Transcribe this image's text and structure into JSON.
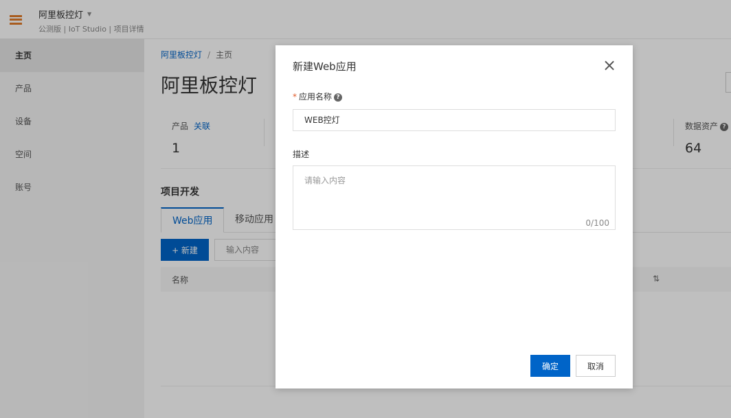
{
  "header": {
    "project_title": "阿里板控灯",
    "caret_icon": "caret-down-icon",
    "subtitle": "公测版 | IoT Studio | 项目详情",
    "accent_color": "#e07b2a"
  },
  "sidebar": {
    "items": [
      {
        "label": "主页"
      },
      {
        "label": "产品"
      },
      {
        "label": "设备"
      },
      {
        "label": "空间"
      },
      {
        "label": "账号"
      }
    ]
  },
  "main": {
    "breadcrumb": {
      "project": "阿里板控灯",
      "sep": "/",
      "current": "主页"
    },
    "title": "阿里板控灯",
    "stats": {
      "product_label": "产品",
      "product_link": "关联",
      "product_value": "1",
      "data_label": "数据资产",
      "data_value": "64"
    },
    "section_title": "项目开发",
    "tabs": [
      {
        "label": "Web应用"
      },
      {
        "label": "移动应用"
      }
    ],
    "new_button": "+ 新建",
    "search_placeholder": "输入内容",
    "table": {
      "columns": [
        "名称"
      ]
    }
  },
  "modal": {
    "title": "新建Web应用",
    "name_label": "应用名称",
    "required_mark": "*",
    "help_icon": "?",
    "name_value": "WEB控灯",
    "desc_label": "描述",
    "desc_placeholder": "请输入内容",
    "counter": "0/100",
    "ok_label": "确定",
    "cancel_label": "取消",
    "primary_color": "#0064c8"
  }
}
